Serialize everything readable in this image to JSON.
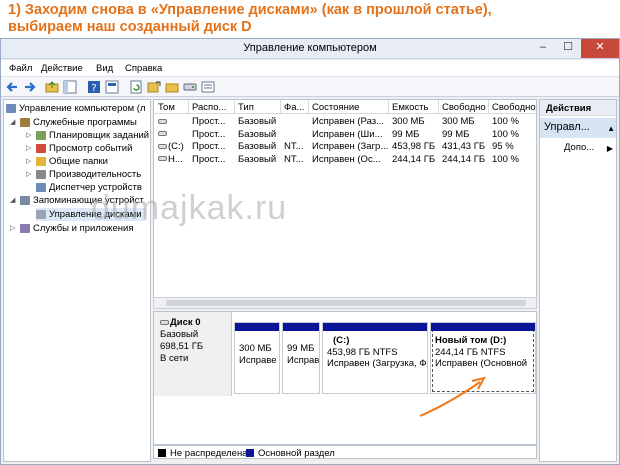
{
  "caption": {
    "line1": "1) Заходим снова в «Управление дисками» (как в прошлой статье),",
    "line2": "выбираем наш созданный диск D"
  },
  "window": {
    "title": "Управление компьютером",
    "minimize": "–",
    "maximize": "☐",
    "close": "✕"
  },
  "menu": [
    "Файл",
    "Действие",
    "Вид",
    "Справка"
  ],
  "tree": {
    "root": "Управление компьютером (л",
    "utilities": "Служебные программы",
    "scheduler": "Планировщик заданий",
    "events": "Просмотр событий",
    "shared": "Общие папки",
    "performance": "Производительность",
    "devices": "Диспетчер устройств",
    "storage": "Запоминающие устройст",
    "diskmgmt": "Управление дисками",
    "services": "Службы и приложения"
  },
  "volumes": {
    "columns": [
      "Том",
      "Распо...",
      "Тип",
      "Фа...",
      "Состояние",
      "Емкость",
      "Свободно",
      "Свободно"
    ],
    "rows": [
      [
        "",
        "Прост...",
        "Базовый",
        "",
        "Исправен (Раз...",
        "300 МБ",
        "300 МБ",
        "100 %"
      ],
      [
        "",
        "Прост...",
        "Базовый",
        "",
        "Исправен (Ши...",
        "99 МБ",
        "99 МБ",
        "100 %"
      ],
      [
        "(C:)",
        "Прост...",
        "Базовый",
        "NT...",
        "Исправен (Загр...",
        "453,98 ГБ",
        "431,43 ГБ",
        "95 %"
      ],
      [
        "Н...",
        "Прост...",
        "Базовый",
        "NT...",
        "Исправен (Ос...",
        "244,14 ГБ",
        "244,14 ГБ",
        "100 %"
      ]
    ]
  },
  "watermark": "dumajkak.ru",
  "disk": {
    "name": "Диск 0",
    "type": "Базовый",
    "size": "698,51 ГБ",
    "status": "В сети",
    "partitions": [
      {
        "title": "",
        "size": "300 МБ",
        "status": "Исправе"
      },
      {
        "title": "",
        "size": "99 МБ",
        "status": "Исправ"
      },
      {
        "title": "(C:)",
        "size": "453,98 ГБ NTFS",
        "status": "Исправен (Загрузка, Ф."
      },
      {
        "title": "Новый том (D:)",
        "size": "244,14 ГБ NTFS",
        "status": "Исправен (Основной"
      }
    ]
  },
  "legend": {
    "unallocated": "Не распределена",
    "primary": "Основной раздел"
  },
  "actions": {
    "header": "Действия",
    "group": "Управл...",
    "more": "Допо..."
  },
  "colors": {
    "caption": "#e4721a",
    "primary_partition": "#0a1596",
    "unallocated": "#000000",
    "annotation_arrow": "#f07a1a"
  }
}
